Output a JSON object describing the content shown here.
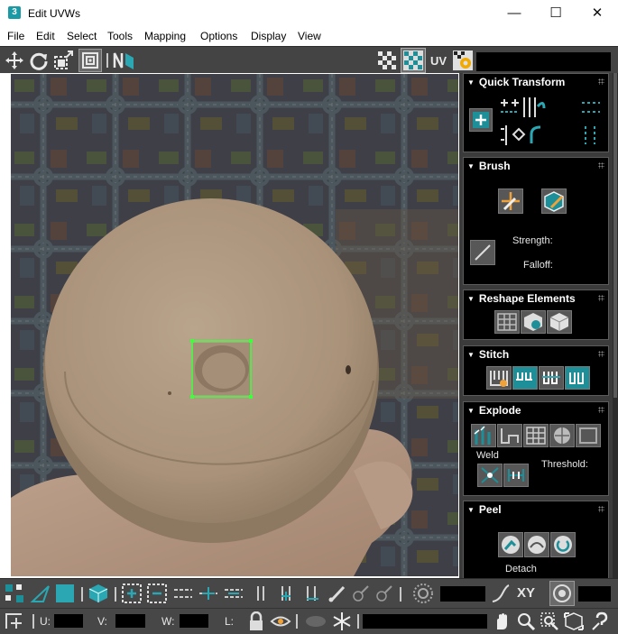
{
  "window": {
    "title": "Edit UVWs",
    "app_icon": "3",
    "controls": {
      "minimize": "—",
      "maximize": "☐",
      "close": "✕"
    }
  },
  "menu": [
    "File",
    "Edit",
    "Select",
    "Tools",
    "Mapping",
    "Options",
    "Display",
    "View"
  ],
  "top_toolbar": {
    "uv_label": "UV",
    "tools": [
      "move-icon",
      "rotate-icon",
      "scale-icon",
      "freeform-icon",
      "mirror-icon"
    ],
    "right_tools": [
      "checker-icon",
      "checker-active-icon",
      "uv-toggle",
      "settings-icon"
    ]
  },
  "panel": {
    "quick_transform": {
      "title": "Quick Transform"
    },
    "brush": {
      "title": "Brush",
      "strength_label": "Strength:",
      "falloff_label": "Falloff:"
    },
    "reshape": {
      "title": "Reshape Elements"
    },
    "stitch": {
      "title": "Stitch"
    },
    "explode": {
      "title": "Explode",
      "weld_label": "Weld",
      "threshold_label": "Threshold:"
    },
    "peel": {
      "title": "Peel",
      "detach_label": "Detach"
    }
  },
  "bottom_toolbar": {
    "xy_label": "XY",
    "u_label": "U:",
    "v_label": "V:",
    "w_label": "W:",
    "l_label": "L:"
  },
  "colors": {
    "accent": "#1d8f99",
    "toolbar_bg": "#444444",
    "panel_bg": "#000000",
    "selection": "#3dff3d"
  }
}
